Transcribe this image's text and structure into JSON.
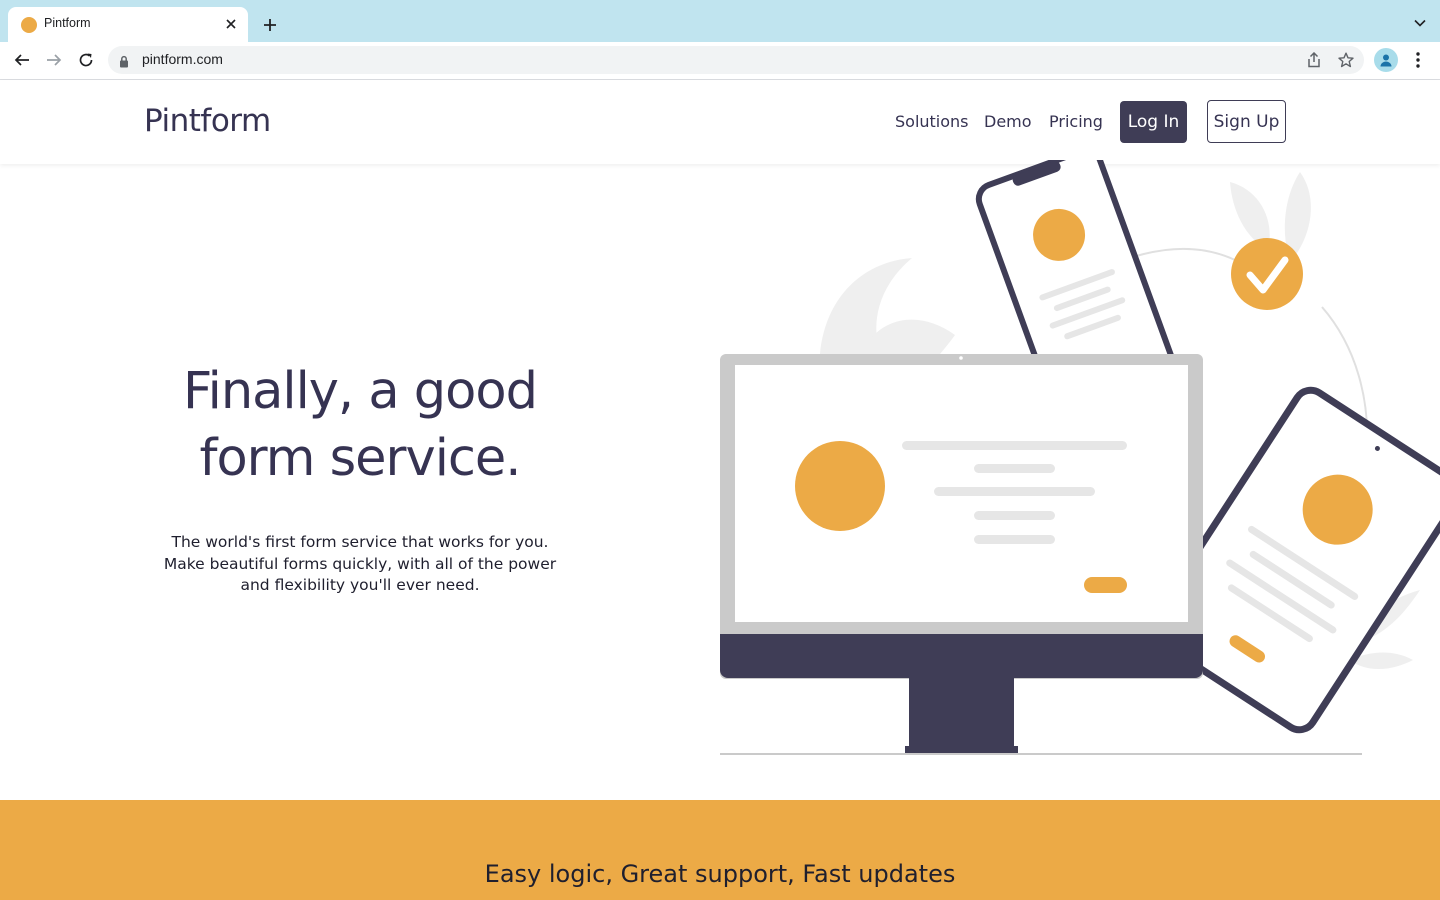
{
  "browser": {
    "tab_title": "Pintform",
    "url": "pintform.com"
  },
  "site": {
    "brand": "Pintform",
    "nav": {
      "solutions": "Solutions",
      "demo": "Demo",
      "pricing": "Pricing",
      "login": "Log In",
      "signup": "Sign Up"
    },
    "hero": {
      "title_line1": "Finally, a good",
      "title_line2": "form service.",
      "subtitle_line1": "The world's first form service that works for you.",
      "subtitle_line2": "Make beautiful forms quickly, with all of the power",
      "subtitle_line3": "and flexibility you'll ever need."
    },
    "band": {
      "text": "Easy logic, Great support, Fast updates"
    }
  },
  "colors": {
    "accent": "#ecaa46",
    "dark": "#3f3d56",
    "tabbar": "#c0e4ef"
  },
  "icons": [
    "favicon-icon",
    "close-icon",
    "plus-icon",
    "chevron-down-icon",
    "back-arrow-icon",
    "forward-arrow-icon",
    "reload-icon",
    "lock-icon",
    "share-icon",
    "star-icon",
    "profile-icon",
    "kebab-menu-icon",
    "checkmark-icon"
  ]
}
